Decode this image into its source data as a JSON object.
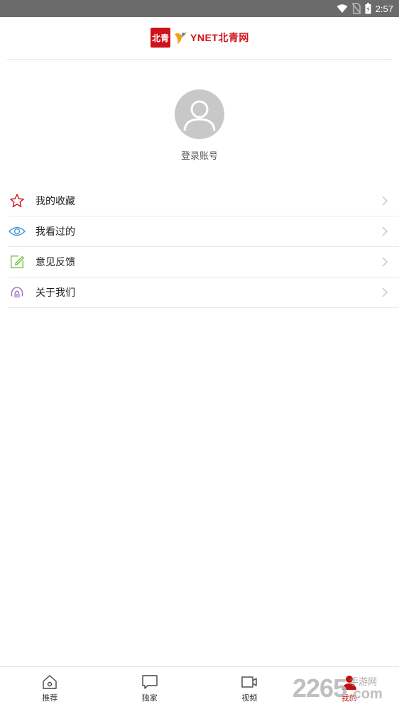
{
  "status_bar": {
    "time": "2:57",
    "icons": [
      "wifi-icon",
      "no-sim-icon",
      "battery-icon"
    ]
  },
  "header": {
    "logo_badge": "北青",
    "logo_text": "YNET北青网"
  },
  "profile": {
    "login_label": "登录账号"
  },
  "menu": {
    "items": [
      {
        "label": "我的收藏",
        "icon": "star-icon",
        "color": "#d0121b"
      },
      {
        "label": "我看过的",
        "icon": "eye-icon",
        "color": "#4a9ad8"
      },
      {
        "label": "意见反馈",
        "icon": "edit-icon",
        "color": "#6fbf3f"
      },
      {
        "label": "关于我们",
        "icon": "info-icon",
        "color": "#9b6fc0"
      }
    ]
  },
  "bottom_nav": {
    "items": [
      {
        "label": "推荐",
        "icon": "home-icon"
      },
      {
        "label": "独家",
        "icon": "chat-icon"
      },
      {
        "label": "视频",
        "icon": "video-icon"
      },
      {
        "label": "我的",
        "icon": "user-icon",
        "active": true
      }
    ],
    "active_color": "#c01010"
  },
  "watermark": {
    "number": "2265",
    "cn": "手游网",
    "com": ".com"
  }
}
